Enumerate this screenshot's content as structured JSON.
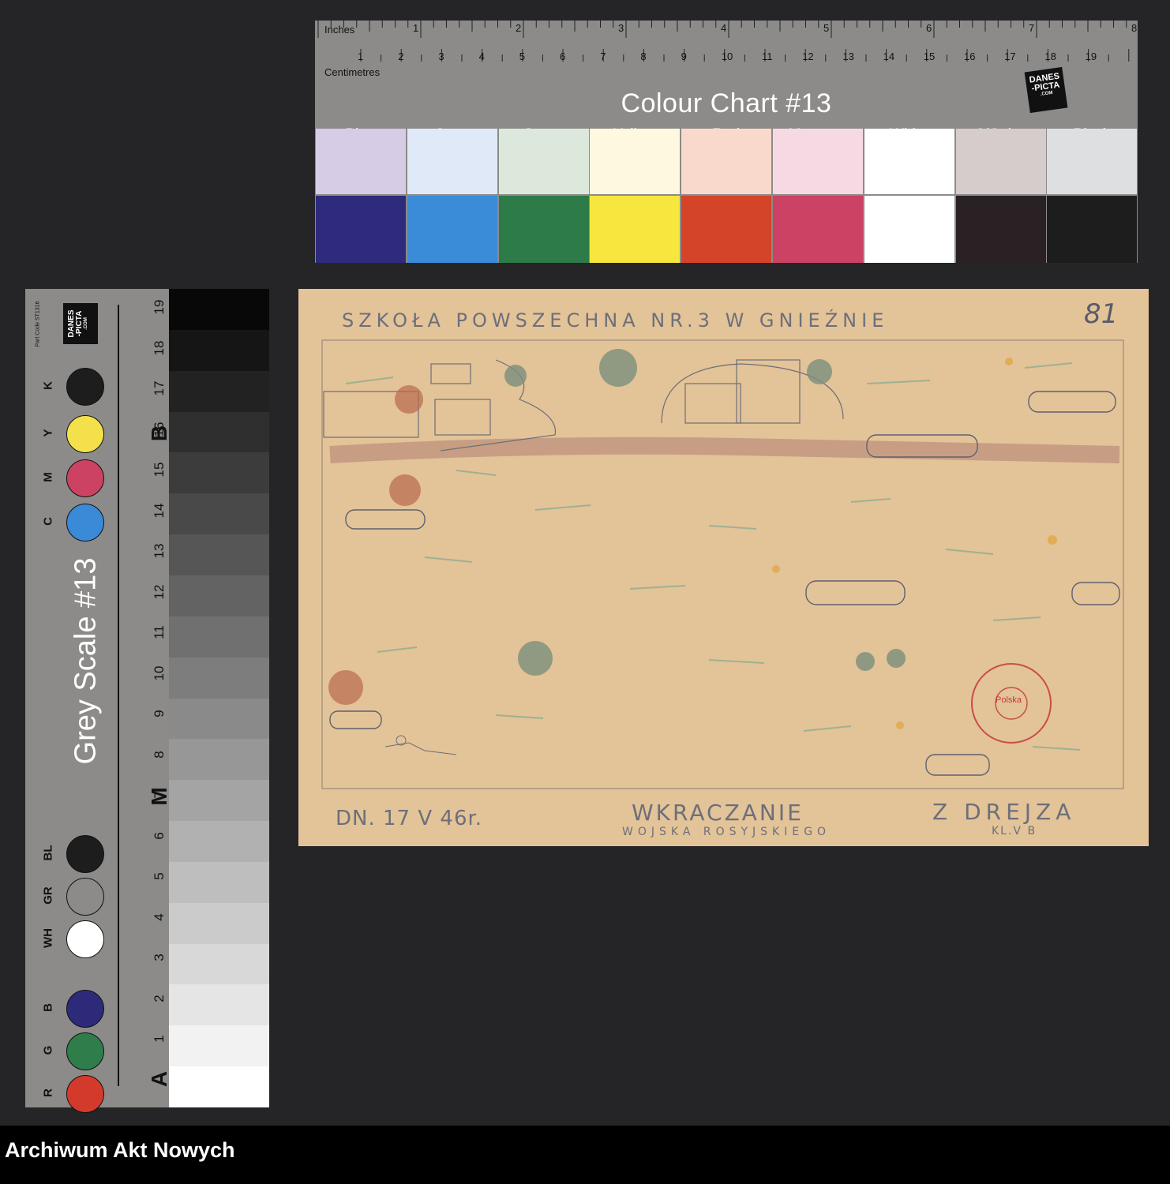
{
  "colour_chart": {
    "inches_label": "Inches",
    "centimetres_label": "Centimetres",
    "inch_numbers": [
      "1",
      "2",
      "3",
      "4",
      "5",
      "6",
      "7",
      "8"
    ],
    "cm_numbers": [
      "1",
      "2",
      "3",
      "4",
      "5",
      "6",
      "7",
      "8",
      "9",
      "10",
      "11",
      "12",
      "13",
      "14",
      "15",
      "16",
      "17",
      "18",
      "19"
    ],
    "title": "Colour Chart #13",
    "logo_line1": "DANES",
    "logo_line2": "-PICTA",
    "logo_line3": ".COM",
    "patches": [
      {
        "label": "Blue",
        "light": "#d6cce6",
        "dark": "#2e2a7c"
      },
      {
        "label": "Cyan",
        "light": "#dfe9f8",
        "dark": "#3a8bd8"
      },
      {
        "label": "Green",
        "light": "#dde8dc",
        "dark": "#2c7b48"
      },
      {
        "label": "Yellow",
        "light": "#fdf8df",
        "dark": "#f6e63e"
      },
      {
        "label": "Red",
        "light": "#f9d9cc",
        "dark": "#d44429"
      },
      {
        "label": "Magenta",
        "light": "#f7d9e4",
        "dark": "#cc4264"
      },
      {
        "label": "White",
        "light": "#ffffff",
        "dark": "#ffffff"
      },
      {
        "label": "3/Color",
        "light": "#d6cccc",
        "dark": "#2a2125"
      },
      {
        "label": "Black",
        "light": "#dedfe1",
        "dark": "#1d1d1e"
      }
    ]
  },
  "grey_scale": {
    "title": "Grey Scale #13",
    "part_code": "Part Code ST1316",
    "numbers": [
      "1",
      "2",
      "3",
      "4",
      "5",
      "6",
      "7",
      "8",
      "9",
      "10",
      "11",
      "12",
      "13",
      "14",
      "15",
      "16",
      "17",
      "18",
      "19"
    ],
    "letters": [
      "A",
      "M",
      "B"
    ],
    "colour_dots": [
      {
        "label": "R",
        "color": "#d43a2c"
      },
      {
        "label": "G",
        "color": "#2f7d4a"
      },
      {
        "label": "B",
        "color": "#2d2a7a"
      },
      {
        "label": "WH",
        "color": "#ffffff"
      },
      {
        "label": "GR",
        "color": "#8c8b89"
      },
      {
        "label": "BL",
        "color": "#1d1d1e"
      },
      {
        "label": "C",
        "color": "#3a8ad8"
      },
      {
        "label": "M",
        "color": "#cc4263"
      },
      {
        "label": "Y",
        "color": "#f4e04b"
      },
      {
        "label": "K",
        "color": "#1d1d1e"
      }
    ],
    "logo_line1": "DANES",
    "logo_line2": "-PICTA",
    "logo_line3": ".COM"
  },
  "drawing": {
    "header": "SZKOŁA POWSZECHNA NR.3 W GNIEŹNIE",
    "page_number": "81",
    "date": "DN. 17 V 46r.",
    "title_line1": "WKRACZANIE",
    "title_line2": "WOJSKA ROSYJSKIEGO",
    "author": "Z DREJZA",
    "class": "KL.V B",
    "stamp_text": "Polska"
  },
  "footer": {
    "archive_name": "Archiwum Akt Nowych"
  }
}
